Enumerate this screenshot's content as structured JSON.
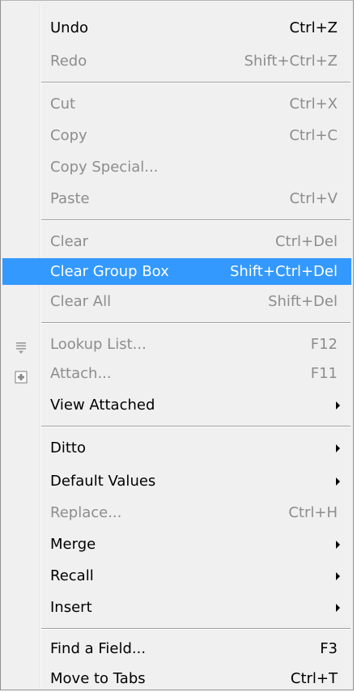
{
  "menu": {
    "items": [
      {
        "label": "Undo",
        "shortcut": "Ctrl+Z"
      },
      {
        "label": "Redo",
        "shortcut": "Shift+Ctrl+Z"
      },
      {
        "label": "Cut",
        "shortcut": "Ctrl+X"
      },
      {
        "label": "Copy",
        "shortcut": "Ctrl+C"
      },
      {
        "label": "Copy Special..."
      },
      {
        "label": "Paste",
        "shortcut": "Ctrl+V"
      },
      {
        "label": "Clear",
        "shortcut": "Ctrl+Del"
      },
      {
        "label": "Clear Group Box",
        "shortcut": "Shift+Ctrl+Del"
      },
      {
        "label": "Clear All",
        "shortcut": "Shift+Del"
      },
      {
        "label": "Lookup List...",
        "shortcut": "F12",
        "icon": "list-icon"
      },
      {
        "label": "Attach...",
        "shortcut": "F11",
        "icon": "attach-icon"
      },
      {
        "label": "View Attached"
      },
      {
        "label": "Ditto"
      },
      {
        "label": "Default Values"
      },
      {
        "label": "Replace...",
        "shortcut": "Ctrl+H"
      },
      {
        "label": "Merge"
      },
      {
        "label": "Recall"
      },
      {
        "label": "Insert"
      },
      {
        "label": "Find a Field...",
        "shortcut": "F3"
      },
      {
        "label": "Move to Tabs",
        "shortcut": "Ctrl+T"
      }
    ]
  },
  "colors": {
    "highlight": "#3399ff",
    "disabled_text": "#8d8d8d",
    "menu_background": "#f0f0f0"
  }
}
